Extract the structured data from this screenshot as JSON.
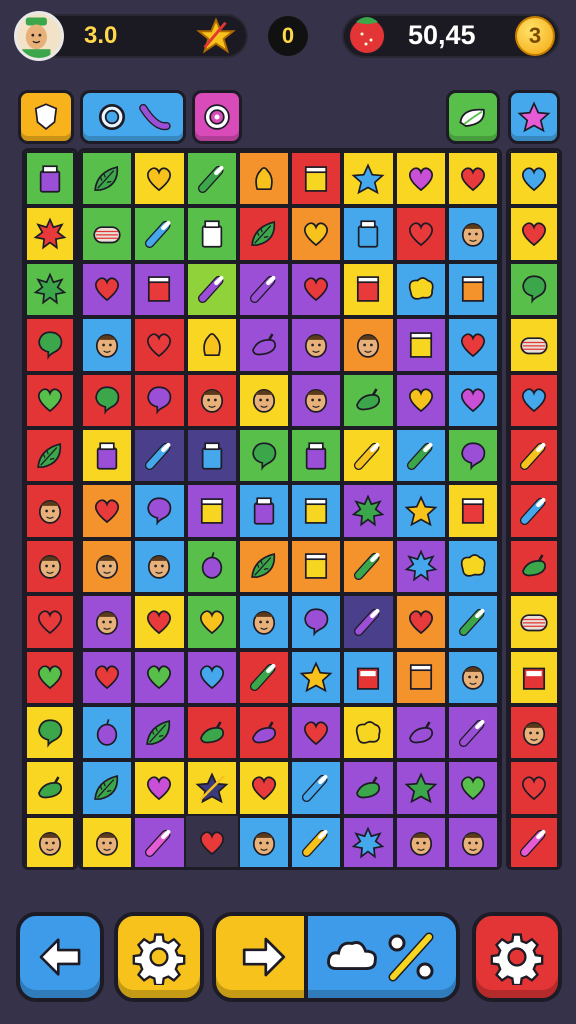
{
  "hud": {
    "level_value": "3.0",
    "center_value": "0",
    "coins_value": "50,45",
    "coin_badge": "3",
    "icons": {
      "avatar": "player-avatar",
      "star": "star-icon",
      "fruit": "strawberry-icon",
      "coin": "coin-icon"
    }
  },
  "tools": [
    {
      "name": "shield-tool",
      "color": "#f7b21c",
      "icons": [
        "shield-icon"
      ]
    },
    {
      "name": "ring-brush-tool",
      "color": "#46a8ec",
      "icons": [
        "ring-icon",
        "brush-icon"
      ]
    },
    {
      "name": "target-tool",
      "color": "#d94bb9",
      "icons": [
        "target-icon"
      ]
    },
    {
      "name": "leaf-tool",
      "color": "#58c04a",
      "icons": [
        "leaf-icon"
      ]
    },
    {
      "name": "star-tool",
      "color": "#46a8ec",
      "icons": [
        "star-icon"
      ]
    }
  ],
  "bottom_bar": [
    {
      "name": "back-button",
      "color": "#3d9be9",
      "icon": "arrow-left-icon"
    },
    {
      "name": "settings-gear-button",
      "color": "#f7c21c",
      "icon": "gear-icon"
    },
    {
      "name": "forward-button",
      "color": "#f7c21c",
      "icon": "arrow-right-icon"
    },
    {
      "name": "cloud-discount-button",
      "color": "#3d9be9",
      "icon": "cloud-percent-icon"
    },
    {
      "name": "red-gear-button",
      "color": "#e33535",
      "icon": "gear-icon"
    }
  ],
  "palette": {
    "R": "#e33535",
    "O": "#f4922c",
    "Y": "#f8d622",
    "G": "#58c04a",
    "L": "#8fd23a",
    "B": "#46a8ec",
    "P": "#9b4fd6",
    "K": "#c84fd6",
    "D": "#4a3f8a"
  },
  "icon_colors": {
    "heart": "#e83a3a",
    "yheart": "#f7c21c",
    "gheart": "#58c04a",
    "bheart": "#46a8ec",
    "pheart": "#c84fd6",
    "leaf": "#3ca64a",
    "bubble": "#3ca64a",
    "pbubble": "#9b4fd6",
    "jar": "#9b4fd6",
    "bjar": "#46a8ec",
    "wjar": "#ffffff",
    "face": "#e9b17a",
    "star": "#f7c21c",
    "gstar": "#3ca64a",
    "bstar": "#46a8ec",
    "pepper": "#3ca64a",
    "ppepper": "#9b4fd6",
    "yblob": "#f7d622",
    "rcan": "#e83a3a",
    "ocan": "#f4922c",
    "ycan": "#f7d622",
    "pbrush": "#9b4fd6",
    "ybrush": "#f7c21c",
    "bbrush": "#46a8ec",
    "gbrush": "#3ca64a",
    "kbrush": "#e85bd6",
    "coil": "#e8e0d6",
    "gberry": "#58c04a",
    "pberry": "#9b4fd6",
    "rburst": "#e83a3a",
    "gburst": "#3ca64a",
    "bburst": "#46a8ec",
    "ystar": "#f7c21c",
    "bell": "#f7c21c",
    "dstar": "#3b3a7a",
    "rcup": "#e83a3a"
  },
  "left_column": [
    [
      "G",
      "jar"
    ],
    [
      "Y",
      "rburst"
    ],
    [
      "G",
      "gburst"
    ],
    [
      "R",
      "bubble"
    ],
    [
      "R",
      "gheart"
    ],
    [
      "R",
      "leaf"
    ],
    [
      "R",
      "face"
    ],
    [
      "R",
      "face"
    ],
    [
      "R",
      "heart"
    ],
    [
      "R",
      "gheart"
    ],
    [
      "Y",
      "bubble"
    ],
    [
      "Y",
      "pepper"
    ],
    [
      "Y",
      "face"
    ]
  ],
  "right_column": [
    [
      "Y",
      "bheart"
    ],
    [
      "Y",
      "heart"
    ],
    [
      "G",
      "bubble"
    ],
    [
      "Y",
      "coil"
    ],
    [
      "R",
      "bheart"
    ],
    [
      "R",
      "ybrush"
    ],
    [
      "R",
      "bbrush"
    ],
    [
      "R",
      "pepper"
    ],
    [
      "Y",
      "coil"
    ],
    [
      "Y",
      "rcup"
    ],
    [
      "R",
      "face"
    ],
    [
      "R",
      "heart"
    ],
    [
      "R",
      "kbrush"
    ]
  ],
  "grid": [
    [
      [
        "G",
        "leaf"
      ],
      [
        "Y",
        "yheart"
      ],
      [
        "G",
        "gbrush"
      ],
      [
        "O",
        "bell"
      ],
      [
        "R",
        "ycan"
      ],
      [
        "Y",
        "bstar"
      ],
      [
        "Y",
        "pheart"
      ],
      [
        "Y",
        "heart"
      ]
    ],
    [
      [
        "G",
        "coil"
      ],
      [
        "G",
        "bbrush"
      ],
      [
        "G",
        "wjar"
      ],
      [
        "R",
        "leaf"
      ],
      [
        "O",
        "yheart"
      ],
      [
        "B",
        "bjar"
      ],
      [
        "R",
        "heart"
      ],
      [
        "B",
        "face"
      ]
    ],
    [
      [
        "P",
        "heart"
      ],
      [
        "P",
        "rcan"
      ],
      [
        "L",
        "pbrush"
      ],
      [
        "P",
        "pbrush"
      ],
      [
        "P",
        "heart"
      ],
      [
        "Y",
        "rcan"
      ],
      [
        "B",
        "yblob"
      ],
      [
        "B",
        "ocan"
      ]
    ],
    [
      [
        "B",
        "face"
      ],
      [
        "R",
        "heart"
      ],
      [
        "Y",
        "bell"
      ],
      [
        "P",
        "ppepper"
      ],
      [
        "P",
        "face"
      ],
      [
        "O",
        "face"
      ],
      [
        "P",
        "ycan"
      ],
      [
        "B",
        "heart"
      ]
    ],
    [
      [
        "R",
        "bubble"
      ],
      [
        "R",
        "pbubble"
      ],
      [
        "R",
        "face"
      ],
      [
        "Y",
        "face"
      ],
      [
        "P",
        "face"
      ],
      [
        "G",
        "pepper"
      ],
      [
        "P",
        "yheart"
      ],
      [
        "B",
        "pheart"
      ]
    ],
    [
      [
        "Y",
        "jar"
      ],
      [
        "D",
        "bbrush"
      ],
      [
        "D",
        "bjar"
      ],
      [
        "G",
        "bubble"
      ],
      [
        "G",
        "jar"
      ],
      [
        "Y",
        "ybrush"
      ],
      [
        "B",
        "gbrush"
      ],
      [
        "G",
        "pbubble"
      ]
    ],
    [
      [
        "O",
        "heart"
      ],
      [
        "B",
        "pbubble"
      ],
      [
        "P",
        "ycan"
      ],
      [
        "B",
        "jar"
      ],
      [
        "B",
        "ycan"
      ],
      [
        "P",
        "gburst"
      ],
      [
        "B",
        "ystar"
      ],
      [
        "Y",
        "rcan"
      ]
    ],
    [
      [
        "O",
        "face"
      ],
      [
        "B",
        "face"
      ],
      [
        "G",
        "pberry"
      ],
      [
        "O",
        "leaf"
      ],
      [
        "O",
        "ycan"
      ],
      [
        "O",
        "gbrush"
      ],
      [
        "P",
        "bburst"
      ],
      [
        "B",
        "yblob"
      ]
    ],
    [
      [
        "P",
        "face"
      ],
      [
        "Y",
        "heart"
      ],
      [
        "G",
        "yheart"
      ],
      [
        "B",
        "face"
      ],
      [
        "B",
        "pbubble"
      ],
      [
        "D",
        "pbrush"
      ],
      [
        "O",
        "heart"
      ],
      [
        "B",
        "gbrush"
      ]
    ],
    [
      [
        "P",
        "heart"
      ],
      [
        "P",
        "gheart"
      ],
      [
        "P",
        "bheart"
      ],
      [
        "R",
        "gbrush"
      ],
      [
        "B",
        "ystar"
      ],
      [
        "B",
        "rcup"
      ],
      [
        "O",
        "ocan"
      ],
      [
        "B",
        "face"
      ]
    ],
    [
      [
        "B",
        "pberry"
      ],
      [
        "P",
        "leaf"
      ],
      [
        "R",
        "pepper"
      ],
      [
        "R",
        "ppepper"
      ],
      [
        "P",
        "heart"
      ],
      [
        "Y",
        "yblob"
      ],
      [
        "P",
        "ppepper"
      ],
      [
        "P",
        "pbrush"
      ]
    ],
    [
      [
        "B",
        "leaf"
      ],
      [
        "Y",
        "pheart"
      ],
      [
        "Y",
        "dstar"
      ],
      [
        "Y",
        "heart"
      ],
      [
        "B",
        "bbrush"
      ],
      [
        "P",
        "pepper"
      ],
      [
        "P",
        "gstar"
      ],
      [
        "P",
        "gheart"
      ]
    ],
    [
      [
        "Y",
        "face"
      ],
      [
        "P",
        "kbrush"
      ],
      [
        "X",
        "heart"
      ],
      [
        "B",
        "face"
      ],
      [
        "B",
        "ybrush"
      ],
      [
        "P",
        "bburst"
      ],
      [
        "P",
        "face"
      ],
      [
        "P",
        "face"
      ]
    ]
  ]
}
